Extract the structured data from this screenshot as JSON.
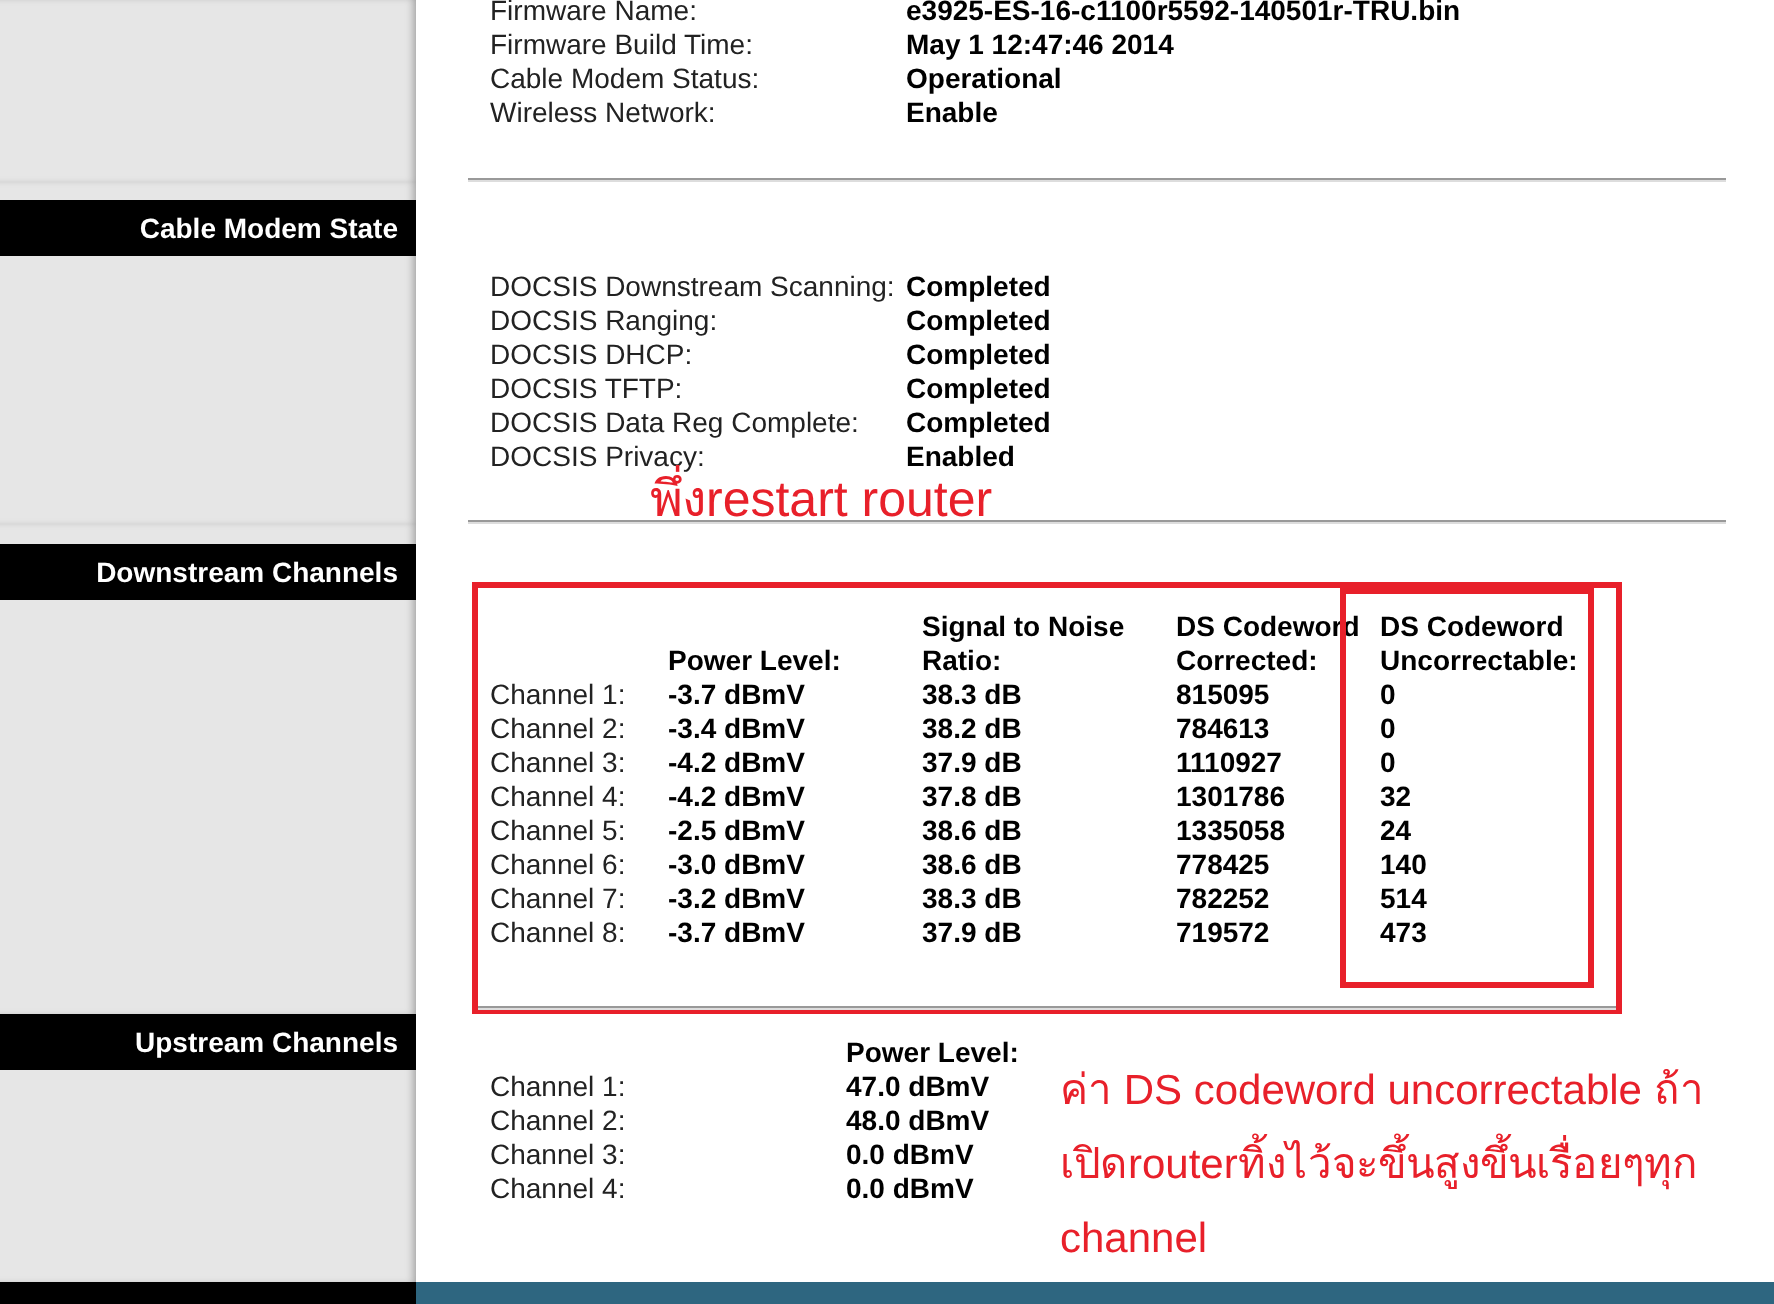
{
  "device_info": [
    {
      "label": "Firmware Name:",
      "value": "e3925-ES-16-c1100r5592-140501r-TRU.bin"
    },
    {
      "label": "Firmware Build Time:",
      "value": "May 1 12:47:46 2014"
    },
    {
      "label": "Cable Modem Status:",
      "value": "Operational"
    },
    {
      "label": "Wireless Network:",
      "value": "Enable"
    }
  ],
  "cable_modem_state": {
    "title": "Cable Modem State",
    "rows": [
      {
        "label": "DOCSIS Downstream Scanning:",
        "value": "Completed"
      },
      {
        "label": "DOCSIS Ranging:",
        "value": "Completed"
      },
      {
        "label": "DOCSIS DHCP:",
        "value": "Completed"
      },
      {
        "label": "DOCSIS TFTP:",
        "value": "Completed"
      },
      {
        "label": "DOCSIS Data Reg Complete:",
        "value": "Completed"
      },
      {
        "label": "DOCSIS Privacy:",
        "value": "Enabled"
      }
    ]
  },
  "downstream_channels": {
    "title": "Downstream Channels",
    "columns": [
      "",
      "Power Level:",
      "Signal to Noise Ratio:",
      "DS Codeword Corrected:",
      "DS Codeword Uncorrectable:"
    ],
    "rows": [
      [
        "Channel 1:",
        "-3.7 dBmV",
        "38.3 dB",
        "815095",
        "0"
      ],
      [
        "Channel 2:",
        "-3.4 dBmV",
        "38.2 dB",
        "784613",
        "0"
      ],
      [
        "Channel 3:",
        "-4.2 dBmV",
        "37.9 dB",
        "1110927",
        "0"
      ],
      [
        "Channel 4:",
        "-4.2 dBmV",
        "37.8 dB",
        "1301786",
        "32"
      ],
      [
        "Channel 5:",
        "-2.5 dBmV",
        "38.6 dB",
        "1335058",
        "24"
      ],
      [
        "Channel 6:",
        "-3.0 dBmV",
        "38.6 dB",
        "778425",
        "140"
      ],
      [
        "Channel 7:",
        "-3.2 dBmV",
        "38.3 dB",
        "782252",
        "514"
      ],
      [
        "Channel 8:",
        "-3.7 dBmV",
        "37.9 dB",
        "719572",
        "473"
      ]
    ]
  },
  "upstream_channels": {
    "title": "Upstream Channels",
    "columns": [
      "",
      "Power Level:"
    ],
    "rows": [
      [
        "Channel 1:",
        "47.0 dBmV"
      ],
      [
        "Channel 2:",
        "48.0 dBmV"
      ],
      [
        "Channel 3:",
        "0.0 dBmV"
      ],
      [
        "Channel 4:",
        "0.0 dBmV"
      ]
    ]
  },
  "annotations": {
    "restart_note": "พึ่งrestart router",
    "uncorrectable_note": [
      "ค่า  DS codeword uncorrectable ถ้า",
      "เปิดrouterทิ้งไว้จะขึ้นสูงขึ้นเรื่อยๆทุก",
      "channel"
    ]
  }
}
